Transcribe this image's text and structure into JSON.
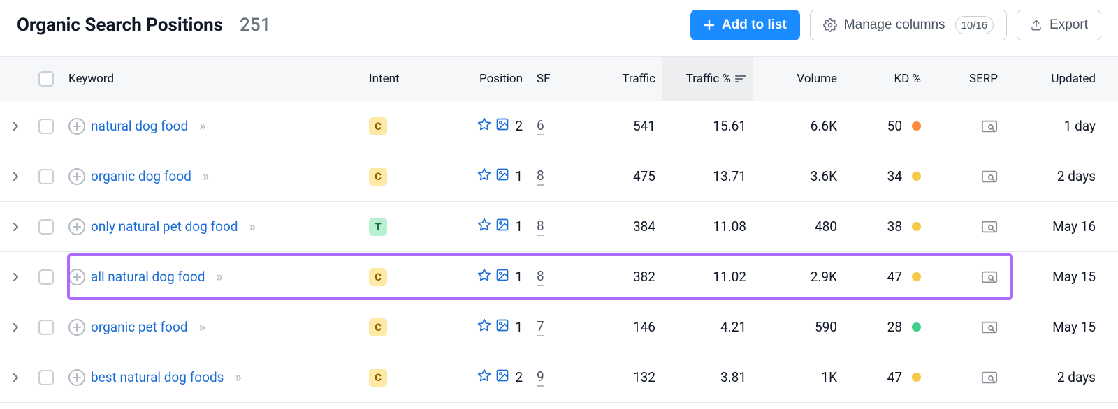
{
  "header": {
    "title": "Organic Search Positions",
    "count": "251",
    "add_to_list": "Add to list",
    "manage_columns": "Manage columns",
    "columns_pill": "10/16",
    "export": "Export"
  },
  "columns": {
    "keyword": "Keyword",
    "intent": "Intent",
    "position": "Position",
    "sf": "SF",
    "traffic": "Traffic",
    "traffic_pct": "Traffic %",
    "volume": "Volume",
    "kd": "KD %",
    "serp": "SERP",
    "updated": "Updated"
  },
  "sort": {
    "column": "traffic_pct",
    "dir": "desc"
  },
  "highlight_index": 3,
  "kd_colors": {
    "orange": "#ff8a3d",
    "yellow": "#f7c948",
    "green": "#3ecf8e"
  },
  "rows": [
    {
      "keyword": "natural dog food",
      "intent": "C",
      "position": "2",
      "sf": "6",
      "traffic": "541",
      "traffic_pct": "15.61",
      "volume": "6.6K",
      "kd": "50",
      "kd_tone": "orange",
      "updated": "1 day"
    },
    {
      "keyword": "organic dog food",
      "intent": "C",
      "position": "1",
      "sf": "8",
      "traffic": "475",
      "traffic_pct": "13.71",
      "volume": "3.6K",
      "kd": "34",
      "kd_tone": "yellow",
      "updated": "2 days"
    },
    {
      "keyword": "only natural pet dog food",
      "intent": "T",
      "position": "1",
      "sf": "8",
      "traffic": "384",
      "traffic_pct": "11.08",
      "volume": "480",
      "kd": "38",
      "kd_tone": "yellow",
      "updated": "May 16"
    },
    {
      "keyword": "all natural dog food",
      "intent": "C",
      "position": "1",
      "sf": "8",
      "traffic": "382",
      "traffic_pct": "11.02",
      "volume": "2.9K",
      "kd": "47",
      "kd_tone": "yellow",
      "updated": "May 15"
    },
    {
      "keyword": "organic pet food",
      "intent": "C",
      "position": "1",
      "sf": "7",
      "traffic": "146",
      "traffic_pct": "4.21",
      "volume": "590",
      "kd": "28",
      "kd_tone": "green",
      "updated": "May 15"
    },
    {
      "keyword": "best natural dog foods",
      "intent": "C",
      "position": "2",
      "sf": "9",
      "traffic": "132",
      "traffic_pct": "3.81",
      "volume": "1K",
      "kd": "47",
      "kd_tone": "yellow",
      "updated": "2 days"
    }
  ]
}
